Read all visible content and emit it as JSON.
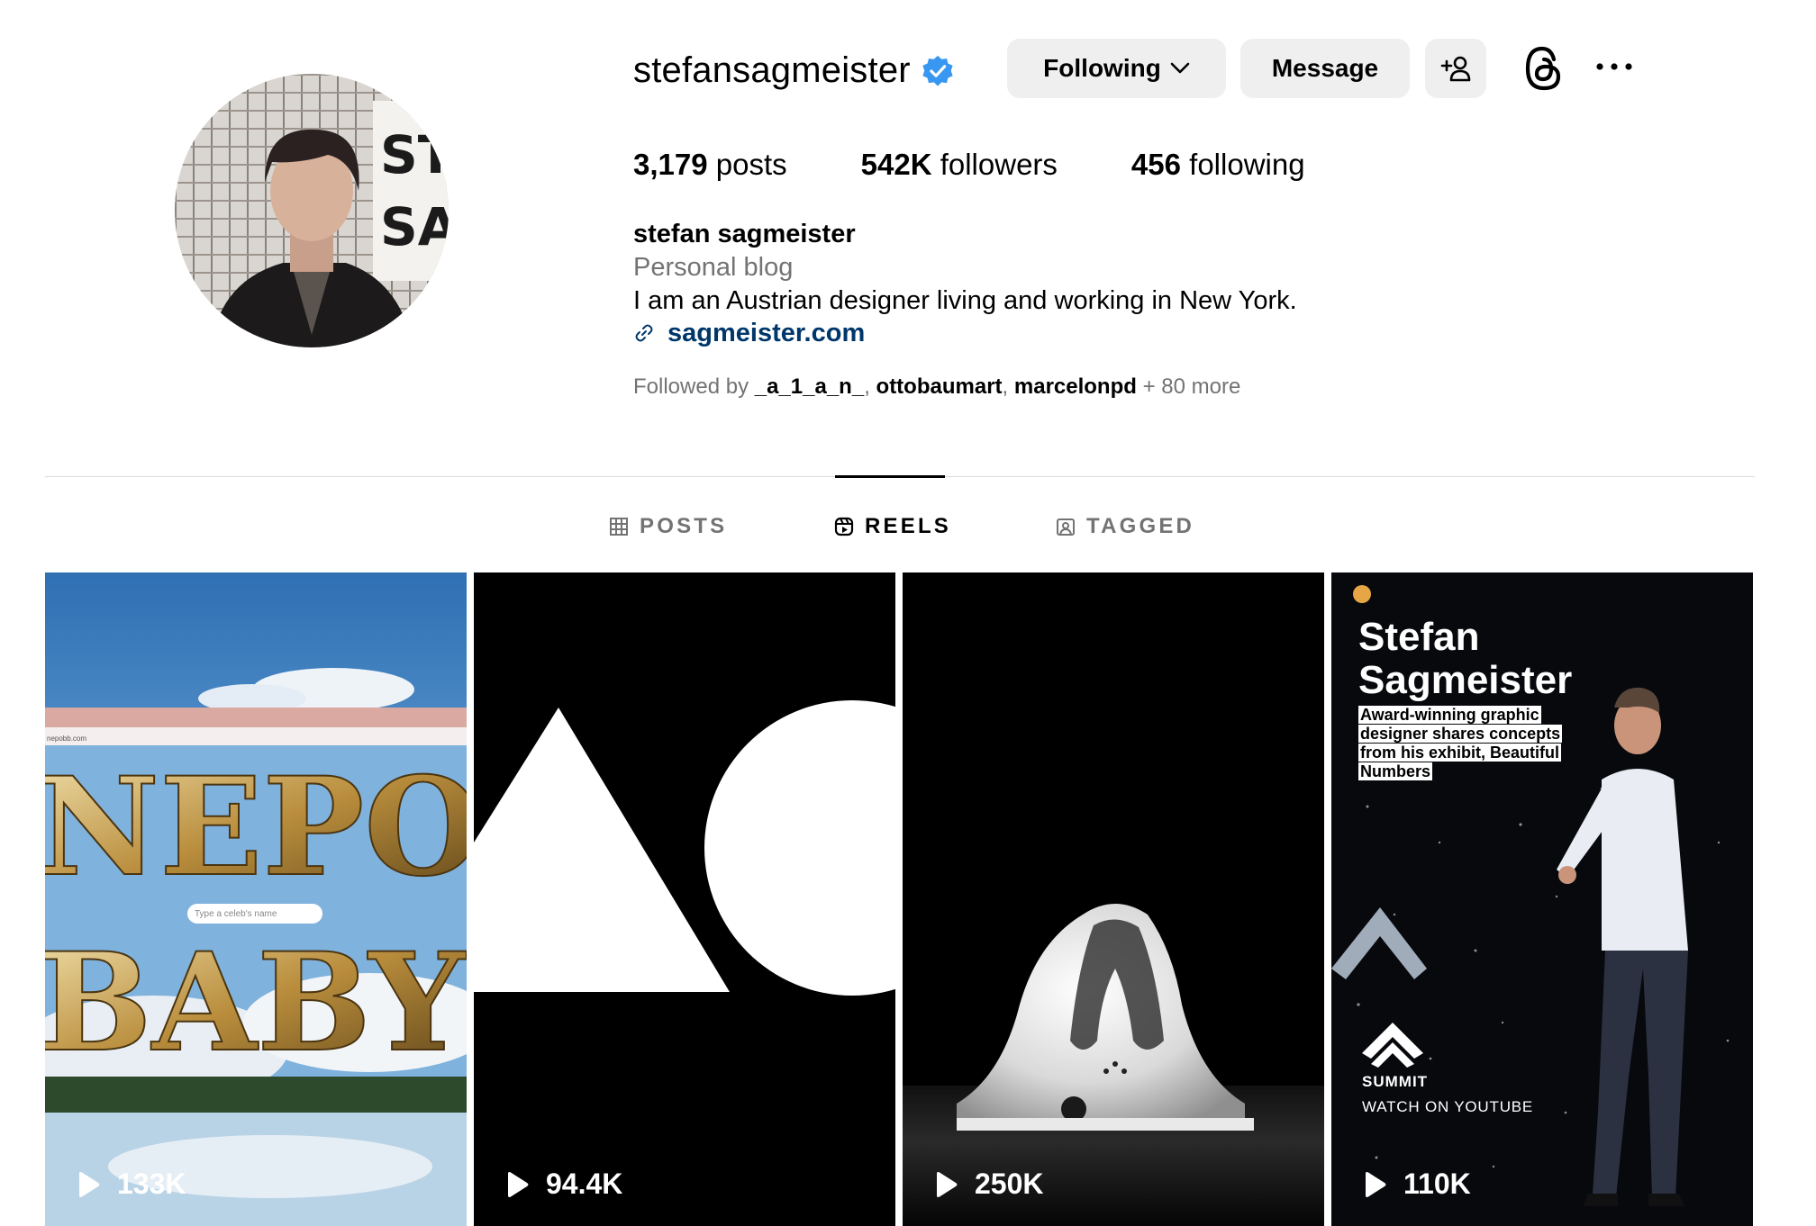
{
  "profile": {
    "username": "stefansagmeister",
    "verified": true,
    "full_name": "stefan sagmeister",
    "category": "Personal blog",
    "bio": "I am an Austrian designer living and working in New York.",
    "link": "sagmeister.com",
    "avatar_icon": "avatar-photo"
  },
  "actions": {
    "following_label": "Following",
    "message_label": "Message",
    "add_user_icon": "add-user-icon",
    "threads_icon": "threads-icon",
    "more_icon": "more-icon"
  },
  "stats": {
    "posts_count": "3,179",
    "posts_label": "posts",
    "followers_count": "542K",
    "followers_label": "followers",
    "following_count": "456",
    "following_label": "following"
  },
  "followed_by": {
    "prefix": "Followed by",
    "names": [
      "_a_1_a_n_",
      "ottobaumart",
      "marcelonpd"
    ],
    "more": "+ 80 more"
  },
  "tabs": [
    {
      "label": "POSTS",
      "icon": "grid-icon",
      "active": false
    },
    {
      "label": "REELS",
      "icon": "reels-icon",
      "active": true
    },
    {
      "label": "TAGGED",
      "icon": "tagged-icon",
      "active": false
    }
  ],
  "reels": [
    {
      "views": "133K",
      "search_placeholder": "Type a celeb's name",
      "url": "nepobb.com"
    },
    {
      "views": "94.4K"
    },
    {
      "views": "250K"
    },
    {
      "views": "110K",
      "title_line1": "Stefan",
      "title_line2": "Sagmeister",
      "subtitle": "Award-winning graphic designer shares concepts from his exhibit, Beautiful Numbers",
      "brand": "SUMMIT",
      "cta": "WATCH ON YOUTUBE"
    }
  ],
  "colors": {
    "verified_blue": "#3897f0",
    "link_blue": "#00376b",
    "button_gray": "#efefef",
    "muted_text": "#737373"
  }
}
